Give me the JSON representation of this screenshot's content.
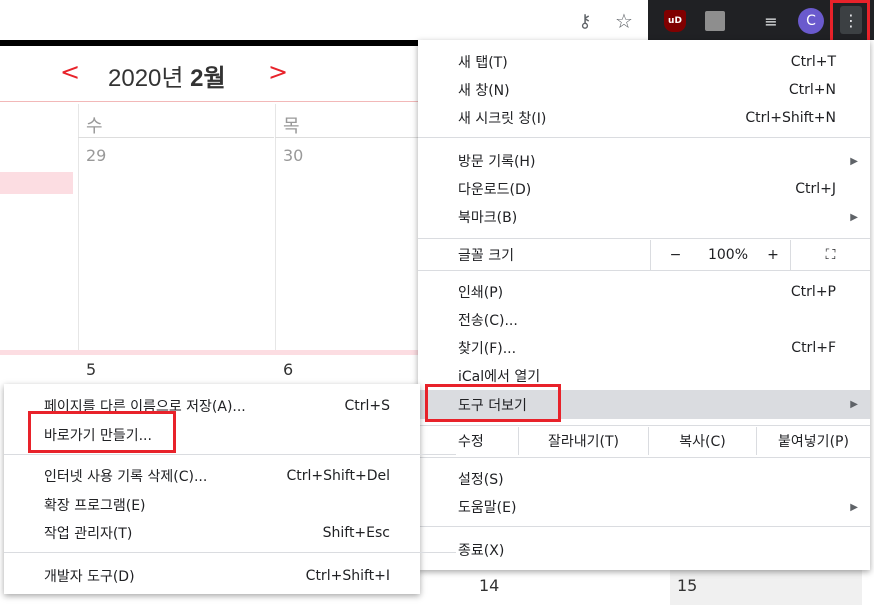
{
  "toolbar": {
    "avatar_initial": "C",
    "icons": [
      "key-icon",
      "star-icon",
      "ublock-icon",
      "photo-extension-icon",
      "media-queue-icon",
      "avatar",
      "more-vert-icon"
    ],
    "ublock_label": "uD"
  },
  "calendar": {
    "prev": "<",
    "next": ">",
    "year_text": "2020년 ",
    "month_text": "2월",
    "days": [
      "수",
      "목"
    ],
    "dates": [
      "29",
      "30",
      "5",
      "6",
      "14",
      "15"
    ]
  },
  "menu": {
    "new_tab": {
      "label": "새 탭(T)",
      "shortcut": "Ctrl+T"
    },
    "new_window": {
      "label": "새 창(N)",
      "shortcut": "Ctrl+N"
    },
    "incognito": {
      "label": "새 시크릿 창(I)",
      "shortcut": "Ctrl+Shift+N"
    },
    "history": {
      "label": "방문 기록(H)"
    },
    "downloads": {
      "label": "다운로드(D)",
      "shortcut": "Ctrl+J"
    },
    "bookmarks": {
      "label": "북마크(B)"
    },
    "zoom": {
      "label": "글꼴 크기",
      "minus": "−",
      "value": "100%",
      "plus": "+"
    },
    "print": {
      "label": "인쇄(P)",
      "shortcut": "Ctrl+P"
    },
    "cast": {
      "label": "전송(C)..."
    },
    "find": {
      "label": "찾기(F)...",
      "shortcut": "Ctrl+F"
    },
    "ical": {
      "label": "iCal에서 열기"
    },
    "more_tools": {
      "label": "도구 더보기"
    },
    "edit": {
      "label": "수정",
      "cut": "잘라내기(T)",
      "copy": "복사(C)",
      "paste": "붙여넣기(P)"
    },
    "settings": {
      "label": "설정(S)"
    },
    "help": {
      "label": "도움말(E)"
    },
    "exit": {
      "label": "종료(X)"
    }
  },
  "submenu": {
    "save_as": {
      "label": "페이지를 다른 이름으로 저장(A)...",
      "shortcut": "Ctrl+S"
    },
    "create_shortcut": {
      "label": "바로가기 만들기..."
    },
    "clear_data": {
      "label": "인터넷 사용 기록 삭제(C)...",
      "shortcut": "Ctrl+Shift+Del"
    },
    "extensions": {
      "label": "확장 프로그램(E)"
    },
    "task_manager": {
      "label": "작업 관리자(T)",
      "shortcut": "Shift+Esc"
    },
    "dev_tools": {
      "label": "개발자 도구(D)",
      "shortcut": "Ctrl+Shift+I"
    }
  },
  "colors": {
    "highlight_box": "#e8222a",
    "calendar_accent": "#e8222a",
    "menu_hover": "#dadce0"
  }
}
